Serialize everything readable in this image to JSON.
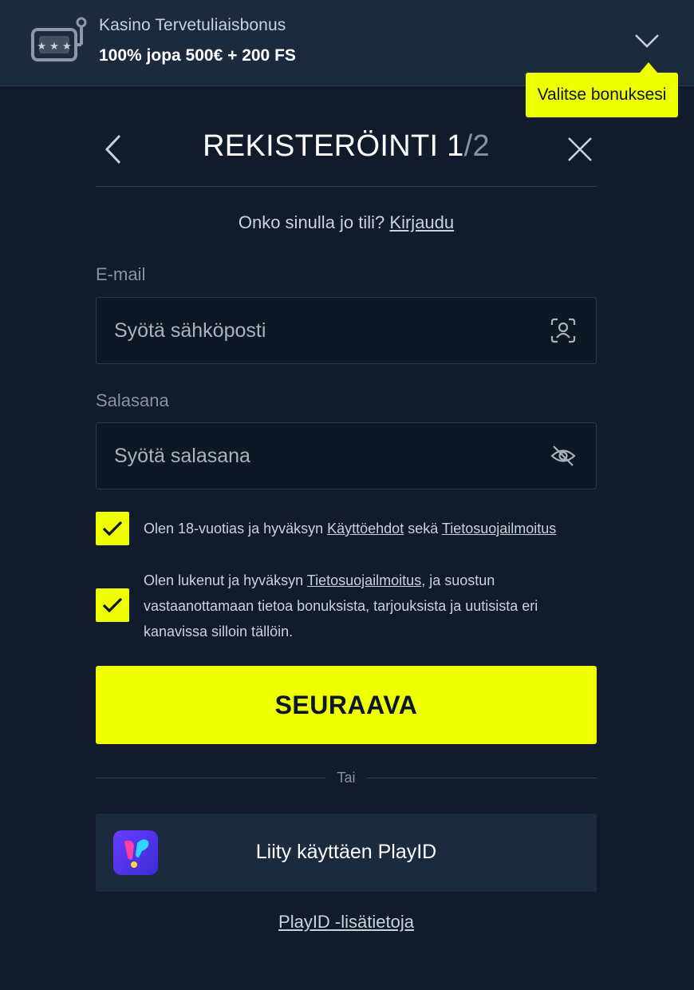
{
  "bonus": {
    "icon": "slot-machine-icon",
    "title": "Kasino Tervetuliaisbonus",
    "offer": "100% jopa 500€ + 200 FS",
    "tooltip": "Valitse bonuksesi"
  },
  "form": {
    "title_main": "REKISTERÖINTI 1",
    "title_sep_total": "/2",
    "login_prompt": "Onko sinulla jo tili?",
    "login_link": "Kirjaudu",
    "email": {
      "label": "E-mail",
      "placeholder": "Syötä sähköposti",
      "icon": "face-scan-icon"
    },
    "password": {
      "label": "Salasana",
      "placeholder": "Syötä salasana",
      "icon": "eye-off-icon"
    },
    "terms": {
      "checked": true,
      "text_before": "Olen 18-vuotias ja hyväksyn ",
      "link1": "Käyttöehdot",
      "text_middle": " sekä ",
      "link2": "Tietosuojailmoitus"
    },
    "marketing": {
      "checked": true,
      "text_before": "Olen lukenut ja hyväksyn ",
      "link": "Tietosuojailmoitus",
      "text_after": ", ja suostun vastaanottamaan tietoa bonuksista, tarjouksista ja uutisista eri kanavissa silloin tällöin."
    },
    "next_button": "SEURAAVA",
    "or_text": "Tai",
    "playid_button": "Liity käyttäen PlayID",
    "playid_info": "PlayID -lisätietoja"
  },
  "colors": {
    "background": "#111b2b",
    "accent": "#eeff00",
    "panel": "#1c2a3d"
  }
}
